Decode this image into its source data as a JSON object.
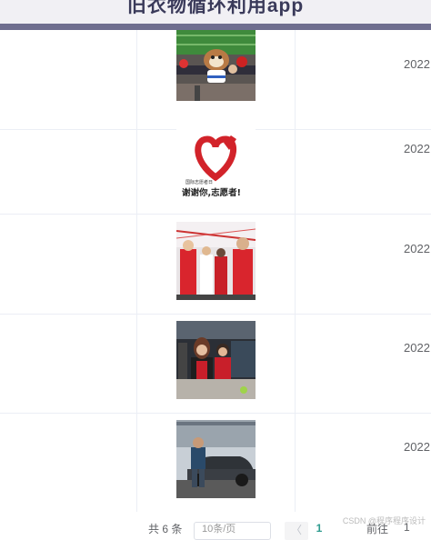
{
  "header": {
    "title": "旧衣物循环利用app"
  },
  "table": {
    "rows": [
      {
        "image": "mascot-photo",
        "date": "2022"
      },
      {
        "image": "volunteer-heart-poster",
        "date": "2022",
        "poster_small_text": "国际志愿者日",
        "poster_text": "谢谢你,志愿者!"
      },
      {
        "image": "volunteers-group-photo",
        "date": "2022"
      },
      {
        "image": "volunteers-indoor-photo",
        "date": "2022"
      },
      {
        "image": "man-with-car-photo",
        "date": "2022"
      }
    ]
  },
  "pagination": {
    "total": "共 6 条",
    "page_size": "10条/页",
    "prev": "〈",
    "current_page": "1",
    "goto": "前往",
    "jump_value": "1"
  },
  "watermark": "CSDN @程序程序设计",
  "colors": {
    "accent": "#6f6e8f",
    "heart": "#d2232a",
    "page_active": "#2e9c8f"
  }
}
